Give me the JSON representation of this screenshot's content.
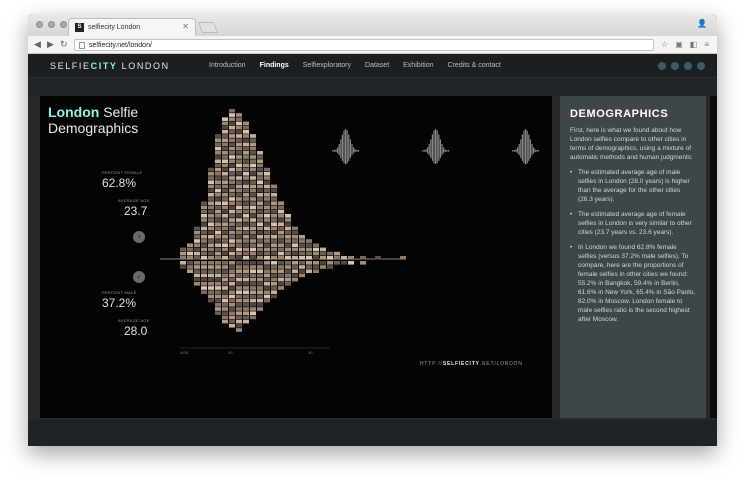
{
  "browser": {
    "tab_title": "selfiecity London",
    "tab_favicon": "S",
    "url": "selfiecity.net/london/",
    "back_icon": "back-arrow-icon",
    "forward_icon": "forward-arrow-icon",
    "reload_icon": "reload-icon"
  },
  "site": {
    "logo": {
      "part1": "SELFIE",
      "part2": "CITY",
      "part3": " LONDON"
    },
    "nav": [
      {
        "label": "Introduction"
      },
      {
        "label": "Findings"
      },
      {
        "label": "Selfiexploratory"
      },
      {
        "label": "Dataset"
      },
      {
        "label": "Exhibition"
      },
      {
        "label": "Credits & contact"
      }
    ],
    "active_nav": "Findings"
  },
  "viz": {
    "title_city": "London",
    "title_rest1": " Selfie",
    "title_rest2": "Demographics",
    "female_label": "PERCENT FEMALE",
    "female_value": "62.8%",
    "female_age_label": "AVERAGE AGE",
    "female_age": "23.7",
    "male_label": "PERCENT MALE",
    "male_value": "37.2%",
    "male_age_label": "AVERAGE AGE",
    "male_age": "28.0",
    "axis_left": "AGE",
    "tick_a": "20",
    "tick_b": "30",
    "url_prefix": "HTTP://",
    "url_bold": "SELFIECITY",
    "url_suffix": ".NET/LONDON",
    "accent_color": "#8ff0e6"
  },
  "panel": {
    "heading": "DEMOGRAPHICS",
    "intro": "First, here is what we found about how London selfies compare to other cities in terms of demographics, using a mixture of automatic methods and human judgments:",
    "bullets": [
      "The estimated average age of male selfies in London (28.0 years) is higher than the average for the other cities (26.3 years).",
      "The estimated average age of female selfies in London is very similar to other cities (23.7 years vs. 23.6 years).",
      "In London we found 62.8% female selfies (versus 37.2% male selfies). To compare, here are the proportions of female selfies in other cities we found: 55.2% in Bangkok, 59.4% in Berlin, 61.6% in New York, 65.4% in São Paolo, 82.0% in Moscow. London female to male selfies ratio is the second highest after Moscow."
    ]
  }
}
